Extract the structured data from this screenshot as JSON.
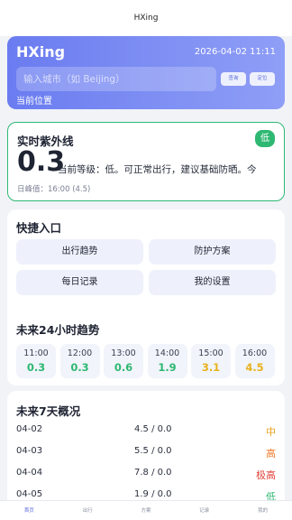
{
  "app_title": "HXing",
  "hero": {
    "name": "HXing",
    "datetime": "2026-04-02 11:11",
    "search_placeholder": "输入城市（如 Beijing）",
    "query_label": "查询",
    "locate_label": "定位",
    "location_label": "当前位置"
  },
  "uv": {
    "title": "实时紫外线",
    "badge": "低",
    "value": "0.3",
    "description": "当前等级：低。可正常出行，建议基础防晒。今",
    "peak": "日峰值：16:00 (4.5)",
    "accent": "#2eb872"
  },
  "quick": {
    "title": "快捷入口",
    "items": [
      "出行趋势",
      "防护方案",
      "每日记录",
      "我的设置"
    ]
  },
  "hours": {
    "title": "未来24小时趋势",
    "items": [
      {
        "time": "11:00",
        "value": "0.3",
        "color": "#2eb872"
      },
      {
        "time": "12:00",
        "value": "0.3",
        "color": "#2eb872"
      },
      {
        "time": "13:00",
        "value": "0.6",
        "color": "#2eb872"
      },
      {
        "time": "14:00",
        "value": "1.9",
        "color": "#2eb872"
      },
      {
        "time": "15:00",
        "value": "3.1",
        "color": "#e8b21c"
      },
      {
        "time": "16:00",
        "value": "4.5",
        "color": "#e8b21c"
      }
    ]
  },
  "week": {
    "title": "未来7天概况",
    "rows": [
      {
        "date": "04-02",
        "range": "4.5 / 0.0",
        "level": "中",
        "color": "#e8a21c"
      },
      {
        "date": "04-03",
        "range": "5.5 / 0.0",
        "level": "高",
        "color": "#f07a2a"
      },
      {
        "date": "04-04",
        "range": "7.8 / 0.0",
        "level": "极高",
        "color": "#e0443a"
      },
      {
        "date": "04-05",
        "range": "1.9 / 0.0",
        "level": "低",
        "color": "#2eb872"
      }
    ]
  },
  "tabs": [
    {
      "label": "首页",
      "active": true
    },
    {
      "label": "出行",
      "active": false
    },
    {
      "label": "方案",
      "active": false
    },
    {
      "label": "记录",
      "active": false
    },
    {
      "label": "我的",
      "active": false
    }
  ]
}
